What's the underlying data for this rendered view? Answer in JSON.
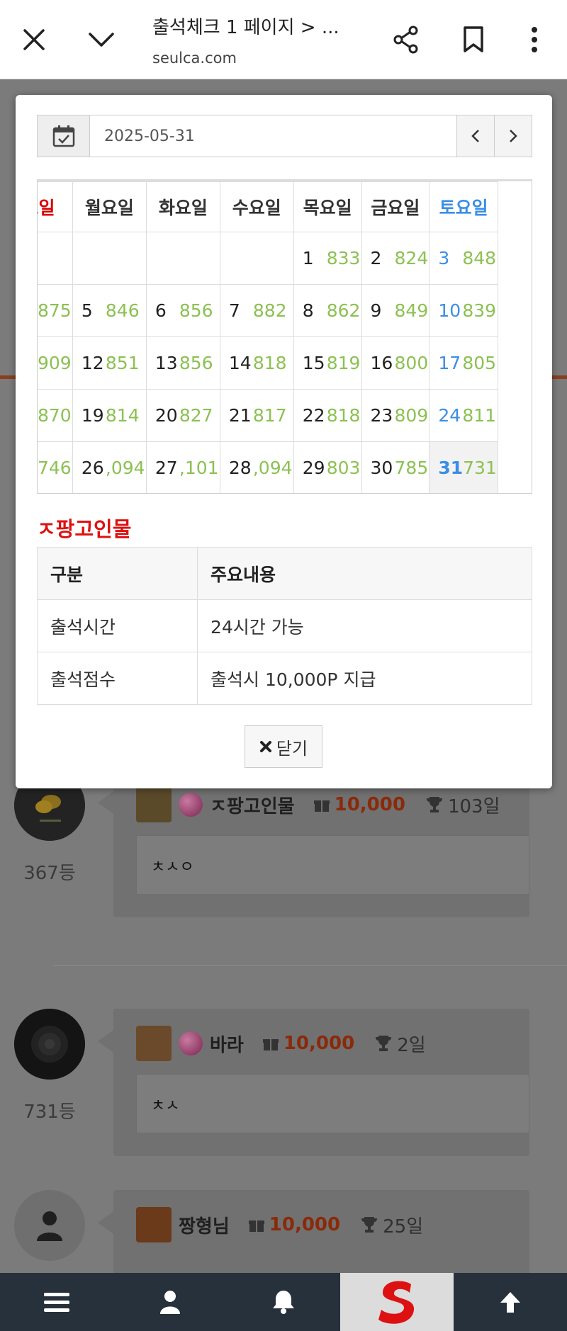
{
  "browser": {
    "title": "출석체크 1 페이지 > ...",
    "url": "seulca.com"
  },
  "modal": {
    "date_value": "2025-05-31",
    "weekdays": [
      "요일",
      "월요일",
      "화요일",
      "수요일",
      "목요일",
      "금요일",
      "토요일"
    ],
    "weeks": [
      [
        {
          "d": "",
          "c": ""
        },
        {
          "d": "",
          "c": ""
        },
        {
          "d": "",
          "c": ""
        },
        {
          "d": "",
          "c": ""
        },
        {
          "d": "1",
          "c": "833"
        },
        {
          "d": "2",
          "c": "824"
        },
        {
          "d": "3",
          "c": "848"
        }
      ],
      [
        {
          "d": "",
          "c": "875"
        },
        {
          "d": "5",
          "c": "846"
        },
        {
          "d": "6",
          "c": "856"
        },
        {
          "d": "7",
          "c": "882"
        },
        {
          "d": "8",
          "c": "862"
        },
        {
          "d": "9",
          "c": "849"
        },
        {
          "d": "10",
          "c": "839"
        }
      ],
      [
        {
          "d": "",
          "c": "909"
        },
        {
          "d": "12",
          "c": "851"
        },
        {
          "d": "13",
          "c": "856"
        },
        {
          "d": "14",
          "c": "818"
        },
        {
          "d": "15",
          "c": "819"
        },
        {
          "d": "16",
          "c": "800"
        },
        {
          "d": "17",
          "c": "805"
        }
      ],
      [
        {
          "d": "",
          "c": "870"
        },
        {
          "d": "19",
          "c": "814"
        },
        {
          "d": "20",
          "c": "827"
        },
        {
          "d": "21",
          "c": "817"
        },
        {
          "d": "22",
          "c": "818"
        },
        {
          "d": "23",
          "c": "809"
        },
        {
          "d": "24",
          "c": "811"
        }
      ],
      [
        {
          "d": "",
          "c": "746"
        },
        {
          "d": "26",
          "c": ",094"
        },
        {
          "d": "27",
          "c": ",101"
        },
        {
          "d": "28",
          "c": ",094"
        },
        {
          "d": "29",
          "c": "803"
        },
        {
          "d": "30",
          "c": "785"
        },
        {
          "d": "31",
          "c": "731"
        }
      ]
    ],
    "section_title": "ㅈ팡고인물",
    "info_table": {
      "headers": [
        "구분",
        "주요내용"
      ],
      "rows": [
        [
          "출석시간",
          "24시간 가능"
        ],
        [
          "출석점수",
          "출석시 10,000P 지급"
        ]
      ]
    },
    "close_label": "닫기"
  },
  "comments": [
    {
      "rank": "367등",
      "nick": "ㅈ팡고인물",
      "points": "10,000",
      "days": "103일",
      "text": "ㅊㅅㅇ",
      "avatar": "coin"
    },
    {
      "rank": "731등",
      "nick": "바라",
      "points": "10,000",
      "days": "2일",
      "text": "ㅊㅅ",
      "avatar": "rose"
    },
    {
      "rank": "",
      "nick": "짱형님",
      "points": "10,000",
      "days": "25일",
      "text": "",
      "avatar": "default"
    }
  ],
  "colors": {
    "sunday": "#d80000",
    "saturday": "#3a8ee6",
    "count": "#8cc152",
    "section_title": "#e01010",
    "bottom_nav": "#27313b"
  },
  "bottom_nav": [
    "menu-icon",
    "user-icon",
    "bell-icon",
    "site-logo",
    "arrow-up-icon"
  ]
}
